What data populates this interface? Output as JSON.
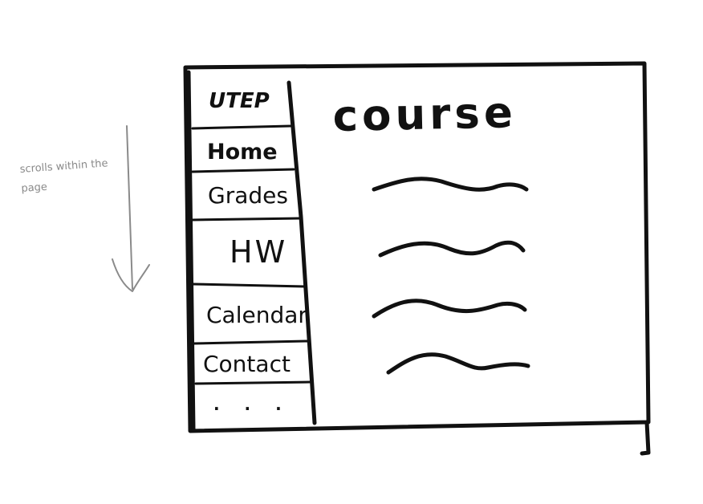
{
  "colors": {
    "ink": "#111111",
    "annotation": "#8a8a8a",
    "background": "#ffffff"
  },
  "sidebar": {
    "items": [
      {
        "label": "UTEP"
      },
      {
        "label": "Home"
      },
      {
        "label": "Grades"
      },
      {
        "label": "HW"
      },
      {
        "label": "Calendar"
      },
      {
        "label": "Contact"
      },
      {
        "label": ". . ."
      }
    ]
  },
  "main": {
    "title": "course",
    "content_lines": 4
  },
  "annotation": {
    "text": "scrolls within the page",
    "icon": "arrow-down-icon"
  }
}
